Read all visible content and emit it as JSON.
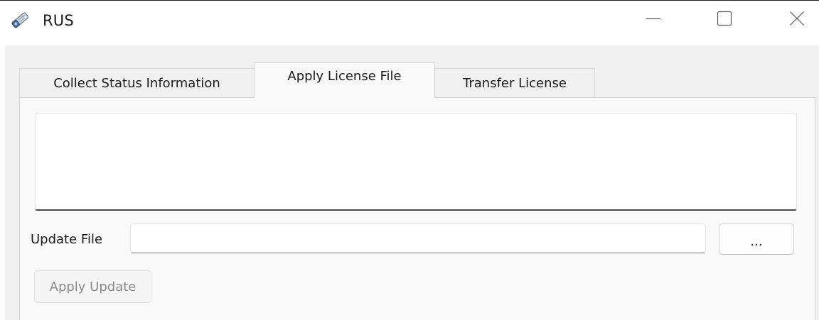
{
  "window": {
    "title": "RUS",
    "icon": "license-key-icon",
    "controls": {
      "minimize": "minimize-icon",
      "maximize": "maximize-icon",
      "close": "close-icon"
    }
  },
  "tabs": [
    {
      "label": "Collect Status Information",
      "active": false
    },
    {
      "label": "Apply License File",
      "active": true
    },
    {
      "label": "Transfer License",
      "active": false
    }
  ],
  "apply_license": {
    "output_text": "",
    "update_file_label": "Update File",
    "update_file_value": "",
    "browse_label": "...",
    "apply_button_label": "Apply Update",
    "apply_button_enabled": false
  },
  "colors": {
    "background": "#f0f0f0",
    "panel": "#f9f9f9",
    "disabled_text": "#8a8a8a"
  }
}
